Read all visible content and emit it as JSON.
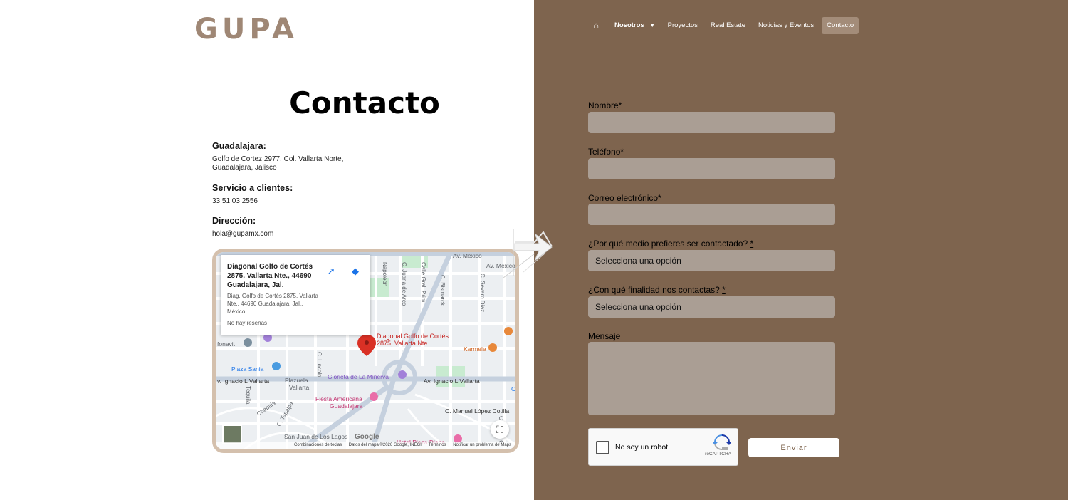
{
  "brand": {
    "logo": "GUPA"
  },
  "nav": {
    "items": [
      {
        "label": "Nosotros"
      },
      {
        "label": "Proyectos"
      },
      {
        "label": "Real Estate"
      },
      {
        "label": "Noticias y Eventos"
      },
      {
        "label": "Contacto"
      }
    ]
  },
  "contact": {
    "title": "Contacto",
    "gdl_head": "Guadalajara:",
    "gdl_line1": "Golfo de Cortez 2977, Col. Vallarta Norte,",
    "gdl_line2": "Guadalajara, Jalisco",
    "service_head": "Servicio a clientes:",
    "service_phone": "33 51 03 2556",
    "address_head": "Dirección:",
    "address_email": "hola@gupamx.com"
  },
  "map": {
    "card_title": "Diagonal Golfo de Cortés 2875, Vallarta Nte., 44690 Guadalajara, Jal.",
    "card_addr": "Diag. Golfo de Cortés 2875, Vallarta Nte., 44690 Guadalajara, Jal., México",
    "card_reviews": "No hay reseñas",
    "pin_label_1": "Diagonal Golfo de Cortés",
    "pin_label_2": "2875, Vallarta Nte...",
    "labels": {
      "av_mexico_1": "Av. México",
      "av_mexico_2": "Av. México",
      "napoleon": "Napoleón",
      "juana_arco": "C. Juana de Arco",
      "bismarck": "C. Bismarck",
      "gral_prim": "Calle Gral. Prim",
      "severo_diaz": "C. Severo Díaz",
      "fonavit": "fonavit",
      "karmele": "Karmele",
      "lincoln": "C. Lincoln",
      "plaza_sania": "Plaza Sania",
      "vallarta_w": "v. Ignacio L Vallarta",
      "vallarta_e": "Av. Ignacio L Vallarta",
      "plazuela": "Plazuela",
      "vallarta_small": "Vallarta",
      "minerva": "Glorieta de La Minerva",
      "fiesta1": "Fiesta Americana",
      "fiesta2": "Guadalajara",
      "tequila": "Tequila",
      "chapala": "Chapala",
      "tapalpa": "C. Tapalpa",
      "san_juan": "San Juan de Los Lagos",
      "manuel_lopez": "C. Manuel López Cotilla",
      "hotel_diana": "Hotel Plaza Diana",
      "emilio": "C. Emilio C",
      "ce": "Ce"
    },
    "google": "Google",
    "footer_shortcuts": "Combinaciones de teclas",
    "footer_data": "Datos del mapa ©2026 Google, INEGI",
    "footer_terms": "Términos",
    "footer_report": "Notificar un problema de Maps"
  },
  "form": {
    "name_label": "Nombre*",
    "phone_label": "Teléfono*",
    "email_label": "Correo electrónico*",
    "medium_label": "¿Por qué medio prefieres ser contactado?",
    "medium_value": "Selecciona una opción",
    "purpose_label": "¿Con qué finalidad nos contactas?",
    "purpose_value": "Selecciona una opción",
    "required_mark": "*",
    "message_label": "Mensaje",
    "recaptcha_text": "No soy un robot",
    "recaptcha_brand": "reCAPTCHA",
    "submit_label": "Enviar"
  },
  "colors": {
    "right_panel": "#7e644e",
    "logo": "#9f8775",
    "input_bg": "#aa9e94",
    "map_border": "#d4c0ad"
  }
}
